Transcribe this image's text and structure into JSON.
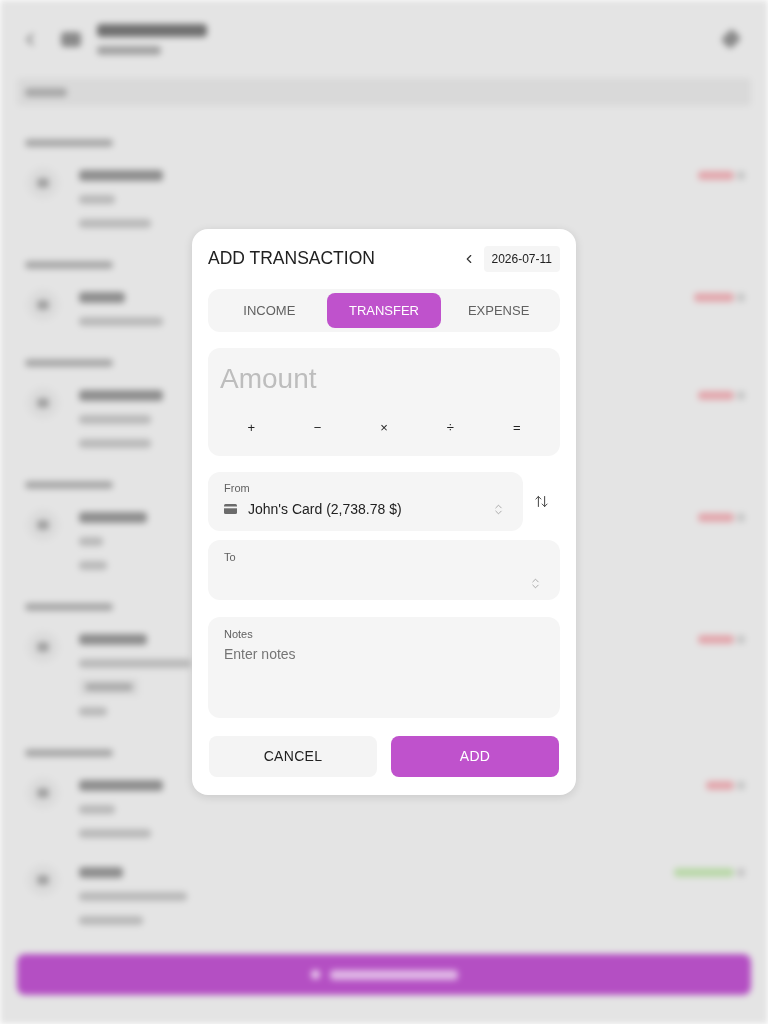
{
  "dialog": {
    "title": "ADD TRANSACTION",
    "date": "2026-07-11",
    "tabs": [
      {
        "label": "INCOME",
        "selected": false
      },
      {
        "label": "TRANSFER",
        "selected": true
      },
      {
        "label": "EXPENSE",
        "selected": false
      }
    ],
    "amount": {
      "placeholder": "Amount",
      "operators": [
        "+",
        "−",
        "×",
        "÷",
        "="
      ]
    },
    "from": {
      "label": "From",
      "value": "John's Card (2,738.78 $)"
    },
    "to": {
      "label": "To"
    },
    "notes": {
      "label": "Notes",
      "placeholder": "Enter notes"
    },
    "buttons": [
      {
        "label": "CANCEL",
        "kind": "secondary"
      },
      {
        "label": "ADD",
        "kind": "primary"
      }
    ]
  }
}
